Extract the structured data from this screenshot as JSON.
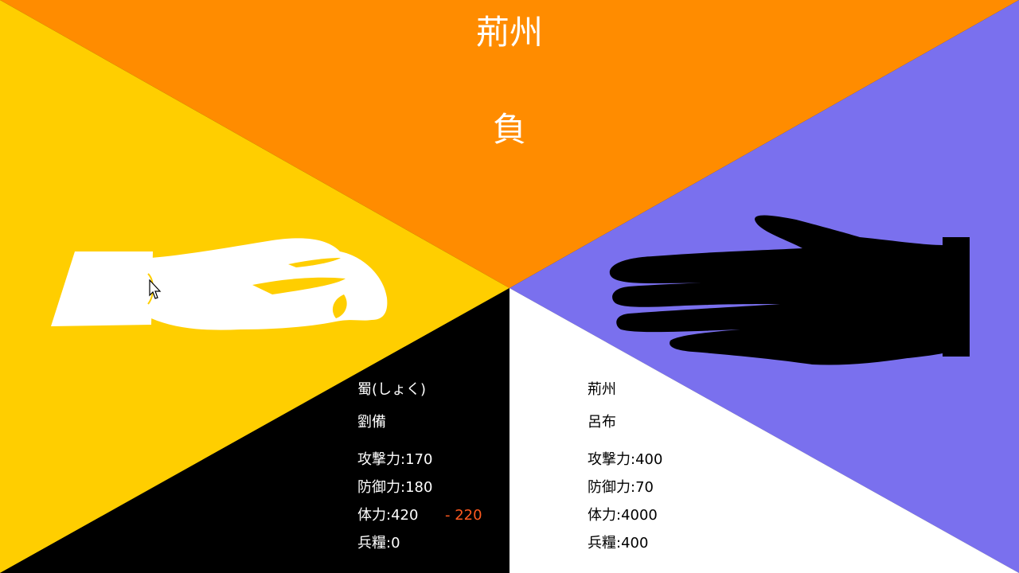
{
  "header": {
    "region": "荊州",
    "result": "負"
  },
  "player": {
    "faction": "蜀(しょく)",
    "general": "劉備",
    "attack": "攻撃力:170",
    "defense": "防御力:180",
    "hp": "体力:420",
    "hp_change": "- 220",
    "food": "兵糧:0",
    "hand": "scissors-hand-icon"
  },
  "enemy": {
    "faction": "荊州",
    "general": "呂布",
    "attack": "攻撃力:400",
    "defense": "防御力:70",
    "hp": "体力:4000",
    "food": "兵糧:400",
    "hand": "paper-hand-icon"
  },
  "colors": {
    "top": "#ff8c00",
    "left": "#ffce00",
    "right": "#7a70ee",
    "bottom_left": "#000000",
    "bottom_right": "#ffffff",
    "damage": "#ff5a1f"
  }
}
